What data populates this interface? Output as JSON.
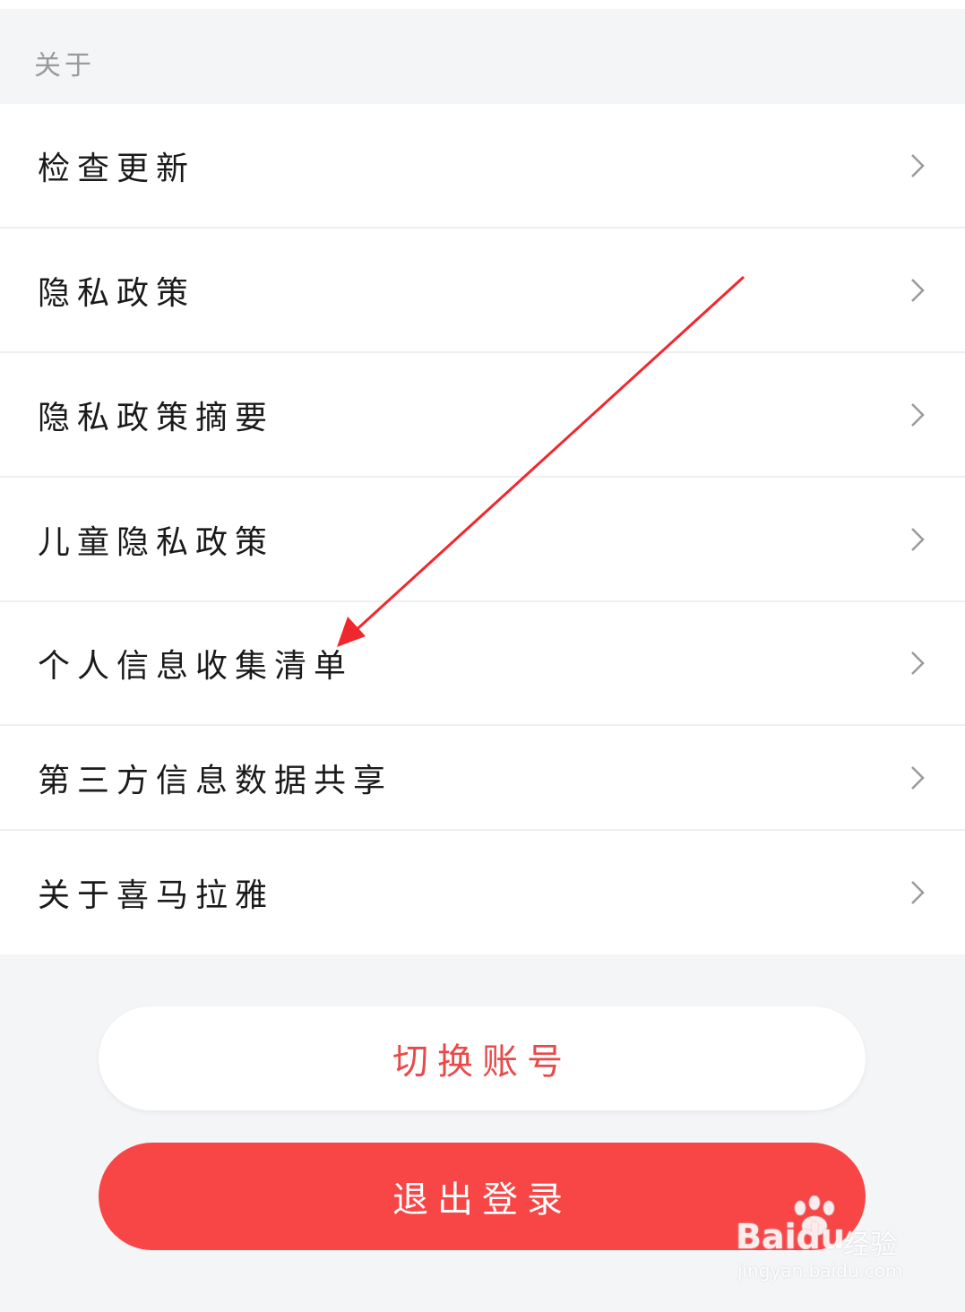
{
  "section": {
    "title": "关于"
  },
  "menu": {
    "items": [
      {
        "label": "检查更新"
      },
      {
        "label": "隐私政策"
      },
      {
        "label": "隐私政策摘要"
      },
      {
        "label": "儿童隐私政策"
      },
      {
        "label": "个人信息收集清单"
      },
      {
        "label": "第三方信息数据共享"
      },
      {
        "label": "关于喜马拉雅"
      }
    ]
  },
  "buttons": {
    "switch_account": "切换账号",
    "logout": "退出登录"
  },
  "watermark": {
    "brand": "Baidu",
    "sub": "经验",
    "url": "jingyan.baidu.com"
  },
  "colors": {
    "accent_red": "#f84545",
    "switch_text": "#e84a4a",
    "arrow": "#f0282d"
  },
  "icons": {
    "chevron": "chevron-right-icon"
  }
}
